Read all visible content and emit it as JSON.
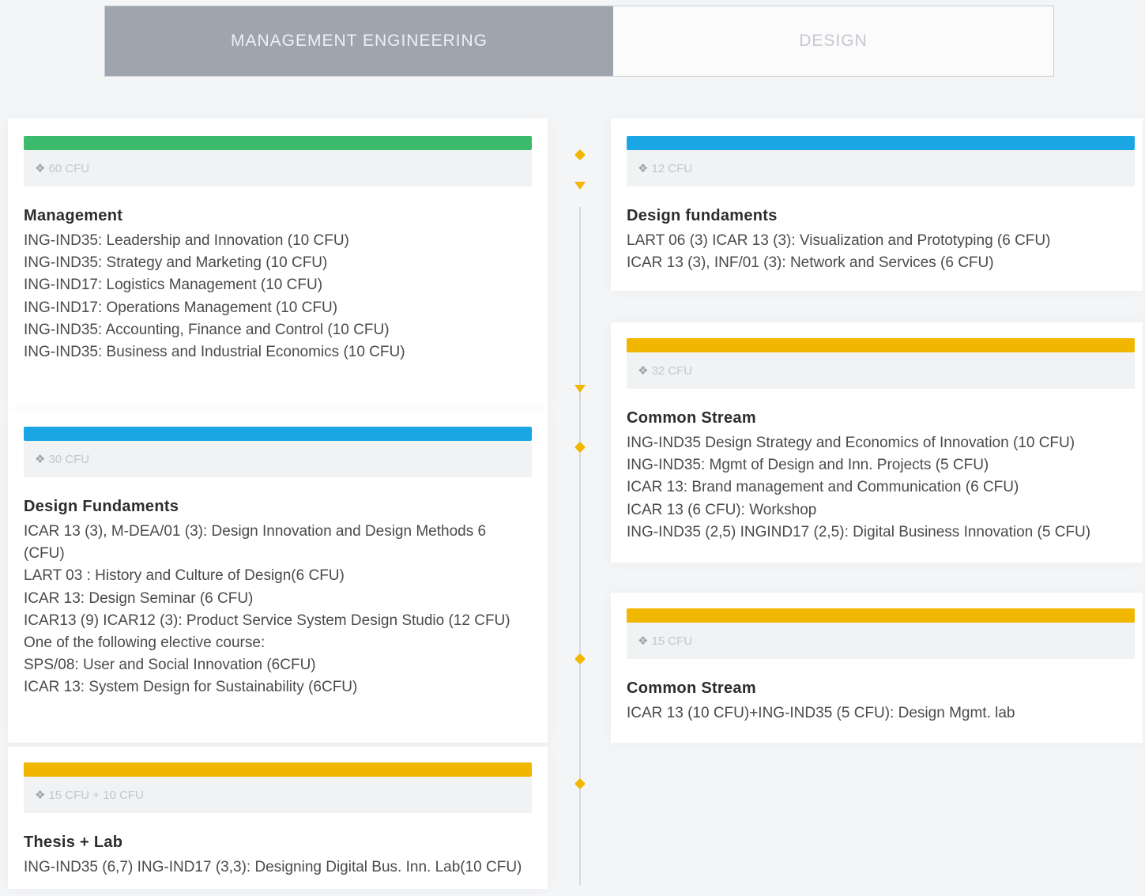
{
  "tabs": [
    {
      "label": "MANAGEMENT ENGINEERING",
      "active": true
    },
    {
      "label": "DESIGN",
      "active": false
    }
  ],
  "colors": {
    "green": "#3dbb6c",
    "blue": "#1aa6e4",
    "yellow": "#f1b600",
    "active_tab": "#9fa5ae"
  },
  "icons": {
    "cfu": "cube-icon",
    "timeline_marker": "diamond-icon",
    "timeline_arrow": "arrow-down-icon"
  },
  "left": {
    "management": {
      "cfu": "60 CFU",
      "title": "Management",
      "items": [
        "ING-IND35: Leadership and Innovation (10 CFU)",
        "ING-IND35: Strategy and Marketing (10 CFU)",
        "ING-IND17: Logistics Management (10 CFU)",
        "ING-IND17: Operations Management (10 CFU)",
        "ING-IND35: Accounting, Finance and Control (10 CFU)",
        "ING-IND35: Business and Industrial Economics (10 CFU)"
      ]
    },
    "design": {
      "cfu": "30 CFU",
      "title": "Design Fundaments",
      "items": [
        "ICAR 13 (3), M-DEA/01 (3): Design Innovation and Design Methods 6",
        "(CFU)",
        "LART 03 : History and Culture of Design(6 CFU)",
        "ICAR 13: Design Seminar (6 CFU)",
        "ICAR13 (9) ICAR12 (3): Product Service System Design Studio (12 CFU)",
        "One of the following elective course:",
        "SPS/08: User and Social Innovation (6CFU)",
        "ICAR 13: System Design for Sustainability (6CFU)"
      ]
    },
    "thesis": {
      "cfu": "15 CFU + 10 CFU",
      "title": "Thesis + Lab",
      "items": [
        "ING-IND35 (6,7) ING-IND17 (3,3): Designing Digital Bus. Inn. Lab(10 CFU)"
      ]
    }
  },
  "right": {
    "design": {
      "cfu": "12 CFU",
      "title": "Design fundaments",
      "items": [
        "LART 06 (3) ICAR 13 (3): Visualization and Prototyping (6 CFU)",
        "ICAR 13 (3), INF/01 (3): Network and Services (6 CFU)"
      ]
    },
    "common1": {
      "cfu": "32 CFU",
      "title": "Common Stream",
      "items": [
        "ING-IND35 Design Strategy and Economics of Innovation (10 CFU)",
        "ING-IND35: Mgmt of Design and Inn. Projects (5 CFU)",
        "ICAR 13: Brand management and Communication (6 CFU)",
        "ICAR 13 (6 CFU): Workshop",
        "ING-IND35 (2,5) INGIND17 (2,5): Digital Business Innovation (5 CFU)"
      ]
    },
    "common2": {
      "cfu": "15 CFU",
      "title": "Common Stream",
      "items": [
        "ICAR 13 (10 CFU)+ING-IND35 (5 CFU): Design Mgmt. lab"
      ]
    }
  }
}
